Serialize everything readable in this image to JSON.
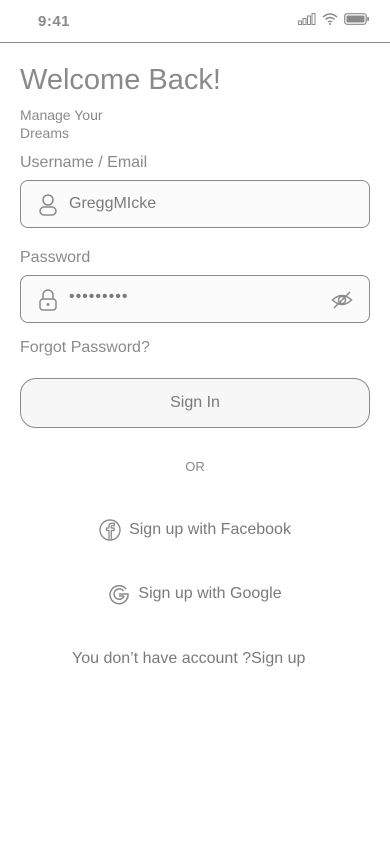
{
  "status": {
    "time": "9:41"
  },
  "header": {
    "title": "Welcome Back!",
    "subtitle": "Manage Your Dreams"
  },
  "username": {
    "label": "Username / Email",
    "value": "GreggMIcke"
  },
  "password": {
    "label": "Password",
    "value": "•••••••••"
  },
  "forgot_label": "Forgot Password?",
  "signin_label": "Sign In",
  "or_label": "OR",
  "social": {
    "facebook_label": "Sign up with Facebook",
    "google_label": "Sign up with Google"
  },
  "footer": {
    "prompt": "You don’t have account ?",
    "link": "Sign up"
  },
  "colors": {
    "stroke": "#8a8a8a",
    "text": "#7a7a7a",
    "background": "#ffffff"
  }
}
